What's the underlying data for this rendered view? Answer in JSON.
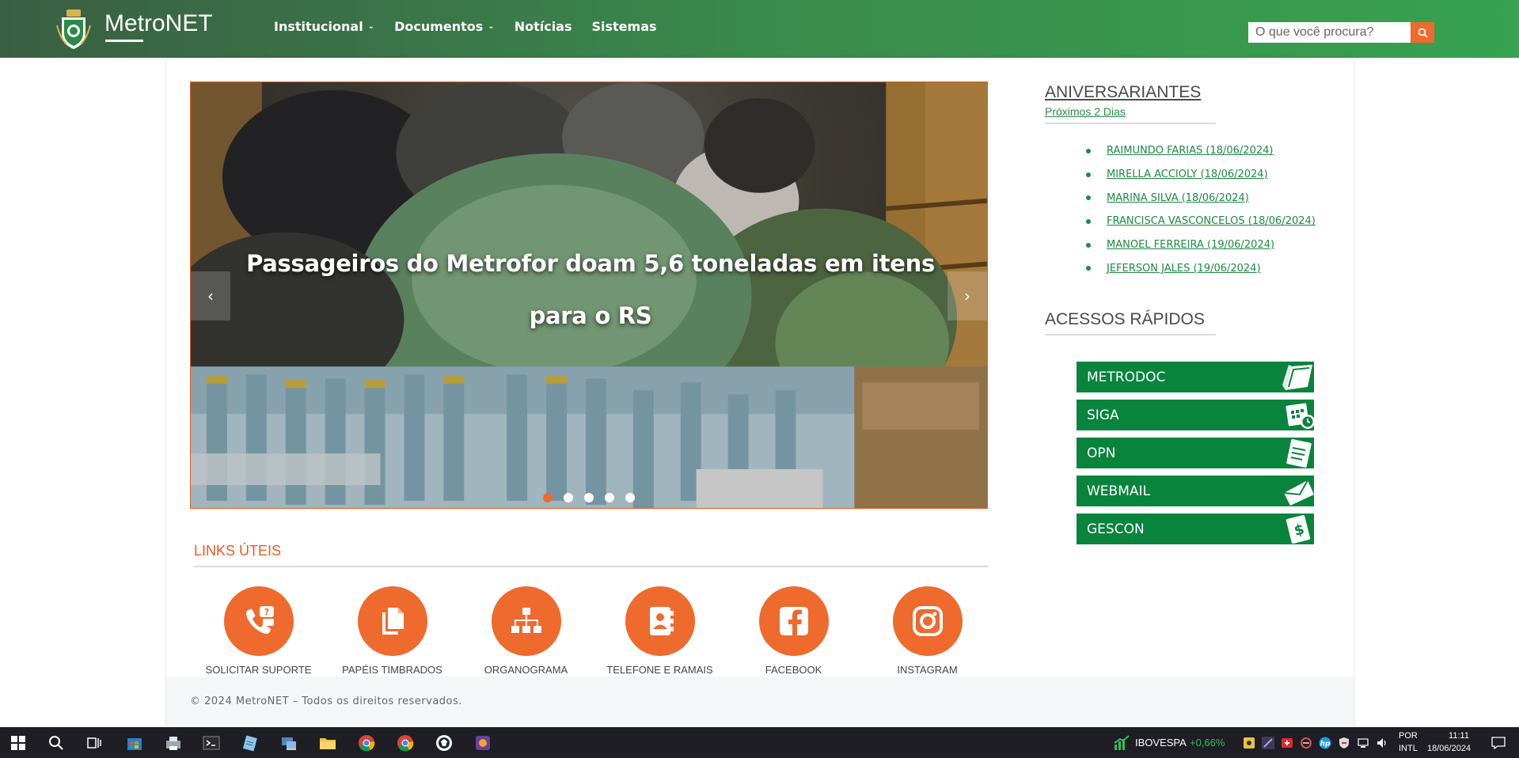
{
  "brand": {
    "name": "MetroNET"
  },
  "nav": {
    "items": [
      {
        "label": "Institucional",
        "has_dropdown": true
      },
      {
        "label": "Documentos",
        "has_dropdown": true
      },
      {
        "label": "Notícias",
        "has_dropdown": false
      },
      {
        "label": "Sistemas",
        "has_dropdown": false
      }
    ]
  },
  "search": {
    "placeholder": "O que você procura?",
    "button_icon": "search-icon"
  },
  "carousel": {
    "caption": "Passageiros do Metrofor doam 5,6 toneladas em itens para o RS",
    "slide_count": 5,
    "active_index": 0
  },
  "links_uteis": {
    "title": "LINKS ÚTEIS",
    "items": [
      {
        "label": "SOLICITAR SUPORTE",
        "icon": "support-phone-icon"
      },
      {
        "label": "PAPÉIS TIMBRADOS",
        "icon": "documents-icon"
      },
      {
        "label": "ORGANOGRAMA",
        "icon": "org-chart-icon"
      },
      {
        "label": "TELEFONE E RAMAIS",
        "icon": "address-book-icon"
      },
      {
        "label": "FACEBOOK",
        "icon": "facebook-icon"
      },
      {
        "label": "INSTAGRAM",
        "icon": "instagram-icon"
      }
    ]
  },
  "aniversariantes": {
    "title": "ANIVERSARIANTES",
    "subtitle": "Próximos 2 Dias",
    "items": [
      "RAIMUNDO FARIAS (18/06/2024)",
      "MIRELLA ACCIOLY (18/06/2024)",
      "MARINA SILVA (18/06/2024)",
      "FRANCISCA VASCONCELOS (18/06/2024)",
      "MANOEL FERREIRA (19/06/2024)",
      "JEFERSON JALES (19/06/2024)"
    ]
  },
  "acessos_rapidos": {
    "title": "ACESSOS RÁPIDOS",
    "items": [
      {
        "label": "METRODOC",
        "icon": "book-icon"
      },
      {
        "label": "SIGA",
        "icon": "calendar-clock-icon"
      },
      {
        "label": "OPN",
        "icon": "document-icon"
      },
      {
        "label": "WEBMAIL",
        "icon": "envelope-icon"
      },
      {
        "label": "GESCON",
        "icon": "money-document-icon"
      }
    ]
  },
  "footer": {
    "text": "© 2024 MetroNET – Todos os direitos reservados."
  },
  "taskbar": {
    "ticker_name": "IBOVESPA",
    "ticker_value": "+0,66%",
    "lang_top": "POR",
    "lang_bottom": "INTL",
    "time": "11:11",
    "date": "18/06/2024"
  },
  "colors": {
    "nav_green": "#3a8a4d",
    "accent_orange": "#ee6a2d",
    "button_green": "#08843d",
    "link_green": "#1e8a42"
  }
}
